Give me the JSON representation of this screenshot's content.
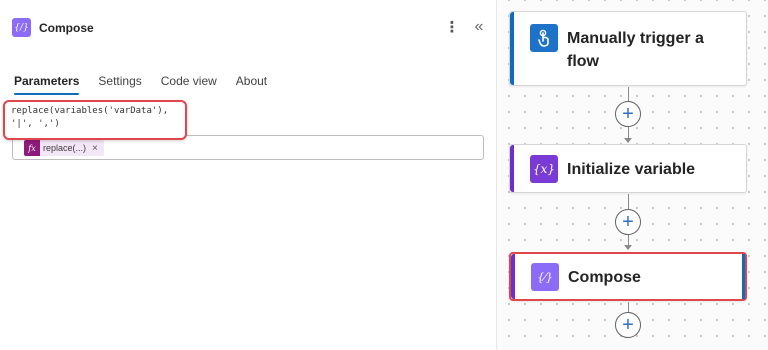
{
  "panel": {
    "title": "Compose",
    "icon": "compose-icon",
    "more_icon": "more-vertical-icon",
    "collapse_icon": "double-chevron-left-icon",
    "tabs": [
      {
        "label": "Parameters",
        "active": true
      },
      {
        "label": "Settings",
        "active": false
      },
      {
        "label": "Code view",
        "active": false
      },
      {
        "label": "About",
        "active": false
      }
    ],
    "expression_token": {
      "label": "replace(...)",
      "fx": "fx",
      "close": "×"
    },
    "callout": {
      "line1": "replace(variables('varData'),",
      "line2": "'|', ',')"
    }
  },
  "canvas": {
    "cards": [
      {
        "label": "Manually trigger a flow",
        "icon": "hand-touch-icon",
        "accent": "#0f6cbd"
      },
      {
        "label": "Initialize variable",
        "icon": "variable-icon",
        "icon_text": "{x}",
        "accent": "#6d2ec9"
      },
      {
        "label": "Compose",
        "icon": "compose-icon",
        "icon_text": "{⁄}",
        "accent": "#6d2ec9",
        "highlighted": true
      }
    ],
    "add_label": "+"
  },
  "colors": {
    "highlight_border": "#e0474c",
    "tab_underline": "#0f6cbd",
    "compose_purple": "#8c6cf6"
  }
}
